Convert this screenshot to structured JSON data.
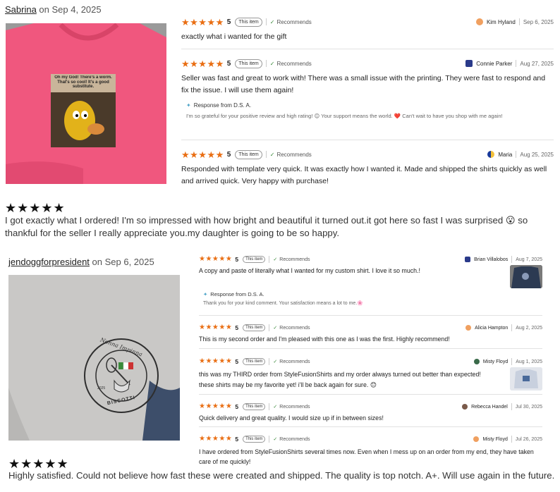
{
  "colors": {
    "star": "#e96e13",
    "pink_shirt": "#f0577e",
    "gray_shirt": "#c9c8c6"
  },
  "post1": {
    "username": "Sabrina",
    "on_date": " on Sep 4, 2025",
    "stars": "★★★★★",
    "text": "I got exactly what I ordered! I'm so impressed with how bright and beautiful it turned out.it got here so fast I was surprised 😮 so thankful for the seller I really appreciate you.my daughter is going to be so happy.",
    "photo_caption": "Oh my God! There's a worm. That's so cool! It's a good substitute."
  },
  "post2": {
    "username": "jendoggforpresident",
    "on_date": " on Sep 6, 2025",
    "stars": "★★★★★",
    "text": "Highly satisfied. Could not believe how fast these were created and shipped. The quality is top notch. A+. Will use again in the future.",
    "logo_top": "Nonna Impinna",
    "logo_bottom": "BISCOTTI",
    "logo_year": "2025"
  },
  "panel1": {
    "reviews": [
      {
        "stars": "★★★★★",
        "rating": "5",
        "badge": "This item",
        "recommends": "Recommends",
        "name": "Kim Hyland",
        "date": "Sep 6, 2025",
        "text": "exactly what i wanted for the gift"
      },
      {
        "stars": "★★★★★",
        "rating": "5",
        "badge": "This item",
        "recommends": "Recommends",
        "name": "Connie Parker",
        "date": "Aug 27, 2025",
        "text": "Seller was fast and great to work with! There was a small issue with the printing. They were fast to respond and fix the issue. I will use them again!"
      },
      {
        "stars": "★★★★★",
        "rating": "5",
        "badge": "This item",
        "recommends": "Recommends",
        "name": "Maria",
        "date": "Aug 25, 2025",
        "text": "Responded with template very quick. It was exactly how I wanted it. Made and shipped the shirts quickly as well and arrived quick. Very happy with purchase!"
      }
    ],
    "response": {
      "title": "Response from D.S. A.",
      "text": "I'm so grateful for your positive review and high rating! 😊 Your support means the world. ❤️ Can't wait to have you shop with me again!"
    }
  },
  "panel2": {
    "reviews": [
      {
        "stars": "★★★★★",
        "rating": "5",
        "badge": "This item",
        "recommends": "Recommends",
        "name": "Brian Villalobos",
        "date": "Aug 7, 2025",
        "text": "A copy and paste of literally what I wanted for my custom shirt. I love it so much.!"
      },
      {
        "stars": "★★★★★",
        "rating": "5",
        "badge": "This item",
        "recommends": "Recommends",
        "name": "Alicia Hampton",
        "date": "Aug 2, 2025",
        "text": "This is my second order and I'm pleased with this one as I was the first. Highly recommend!"
      },
      {
        "stars": "★★★★★",
        "rating": "5",
        "badge": "This item",
        "recommends": "Recommends",
        "name": "Misty Floyd",
        "date": "Aug 1, 2025",
        "text": "this was my THIRD order from StyleFusionShirts and my order always turned out better than expected! these shirts may be my favorite yet! i'll be back again for sure. 😊"
      },
      {
        "stars": "★★★★★",
        "rating": "5",
        "badge": "This item",
        "recommends": "Recommends",
        "name": "Rebecca Handel",
        "date": "Jul 30, 2025",
        "text": "Quick delivery and great quality. I would size up if in between sizes!"
      },
      {
        "stars": "★★★★★",
        "rating": "5",
        "badge": "This item",
        "recommends": "Recommends",
        "name": "Misty Floyd",
        "date": "Jul 26, 2025",
        "text": "I have ordered from StyleFusionShirts several times now. Even when I mess up on an order from my end, they have taken care of me quickly!"
      }
    ],
    "response": {
      "title": "Response from D.S. A.",
      "text": "Thank you for your kind comment. Your satisfaction means a lot to me.🌸"
    }
  }
}
